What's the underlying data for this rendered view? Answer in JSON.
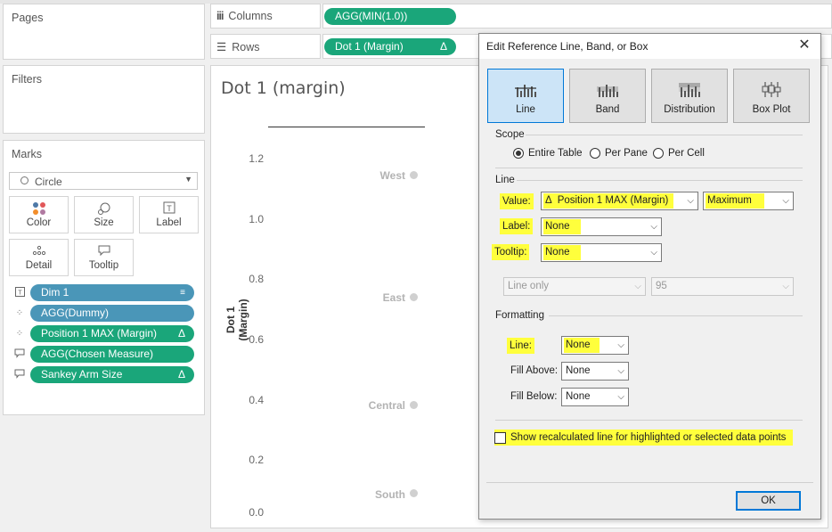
{
  "panels": {
    "pages": "Pages",
    "filters": "Filters",
    "marks": "Marks"
  },
  "shelves": {
    "columns_label": "Columns",
    "columns_pill": "AGG(MIN(1.0))",
    "rows_label": "Rows",
    "rows_pill": "Dot 1 (Margin)",
    "rows_pill_delta": "Δ"
  },
  "marks_card": {
    "mark_type": "Circle",
    "buttons": [
      "Color",
      "Size",
      "Label",
      "Detail",
      "Tooltip"
    ],
    "fields": [
      {
        "name": "Dim 1",
        "color": "#4a96b8"
      },
      {
        "name": "AGG(Dummy)",
        "color": "#4a96b8"
      },
      {
        "name": "Position 1 MAX (Margin)",
        "color": "#1aa67a",
        "delta": "Δ"
      },
      {
        "name": "AGG(Chosen Measure)",
        "color": "#1aa67a"
      },
      {
        "name": "Sankey Arm Size",
        "color": "#1aa67a",
        "delta": "Δ"
      }
    ]
  },
  "viz": {
    "title": "Dot 1 (margin)",
    "ylabel": "Dot 1 (Margin)",
    "yticks": [
      "1.2",
      "1.0",
      "0.8",
      "0.6",
      "0.4",
      "0.2",
      "0.0"
    ],
    "categories": [
      "West",
      "East",
      "Central",
      "South"
    ]
  },
  "chart_data": {
    "type": "scatter",
    "title": "Dot 1 (margin)",
    "ylabel": "Dot 1 (Margin)",
    "ylim": [
      0,
      1.2
    ],
    "points": [
      {
        "label": "West",
        "y": 1.14
      },
      {
        "label": "East",
        "y": 0.73
      },
      {
        "label": "Central",
        "y": 0.37
      },
      {
        "label": "South",
        "y": 0.06
      }
    ]
  },
  "dialog": {
    "title": "Edit Reference Line, Band, or Box",
    "close": "✕",
    "types": [
      "Line",
      "Band",
      "Distribution",
      "Box Plot"
    ],
    "active_type": "Line",
    "scope": {
      "title": "Scope",
      "options": [
        "Entire Table",
        "Per Pane",
        "Per Cell"
      ],
      "selected": "Entire Table"
    },
    "line": {
      "title": "Line",
      "value_label": "Value:",
      "value_field_icon": "Δ",
      "value_field": "Position 1 MAX (Margin)",
      "aggregation": "Maximum",
      "label_label": "Label:",
      "label_value": "None",
      "tooltip_label": "Tooltip:",
      "tooltip_value": "None",
      "line_only": "Line only",
      "confidence": "95"
    },
    "formatting": {
      "title": "Formatting",
      "line_label": "Line:",
      "line_value": "None",
      "fill_above_label": "Fill Above:",
      "fill_above_value": "None",
      "fill_below_label": "Fill Below:",
      "fill_below_value": "None"
    },
    "recalc_checkbox": "Show recalculated line for highlighted or selected data points",
    "ok": "OK"
  },
  "colors": {
    "green_pill": "#1aa67a",
    "blue_pill": "#4a96b8",
    "highlight": "#ffff3c",
    "accent": "#0078d7"
  }
}
